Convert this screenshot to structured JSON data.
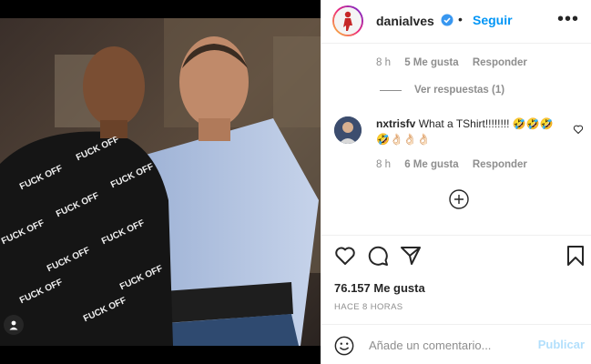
{
  "post": {
    "photo": {
      "shirt_text": [
        "FUCK OFF",
        "FUCK OFF",
        "FUCK OFF",
        "FUCK OFF",
        "FUCK OFF",
        "FUCK OFF",
        "FUCK OFF",
        "FUCK OFF",
        "FUCK OFF",
        "FUCK OFF",
        "FUCK OFF",
        "FUCK OFF",
        "FUCK OFF",
        "FUCK OFF"
      ]
    }
  },
  "header": {
    "username": "danialves",
    "separator": "•",
    "follow_label": "Seguir",
    "more_label": "•••"
  },
  "comments": {
    "first_meta": {
      "time": "8 h",
      "likes": "5 Me gusta",
      "reply": "Responder"
    },
    "view_replies": "Ver respuestas (1)",
    "second": {
      "username": "nxtrisfv",
      "text": "What a TShirt!!!!!!!! 🤣🤣🤣🤣👌🏻👌🏻👌🏻",
      "time": "8 h",
      "likes": "6 Me gusta",
      "reply": "Responder"
    }
  },
  "actions": {
    "likes": "76.157 Me gusta",
    "date": "HACE 8 HORAS"
  },
  "comment_box": {
    "placeholder": "Añade un comentario...",
    "publish_label": "Publicar"
  },
  "colors": {
    "link_blue": "#0095f6",
    "publish_disabled": "#b2dffc",
    "muted": "#8e8e8e",
    "text": "#262626"
  }
}
